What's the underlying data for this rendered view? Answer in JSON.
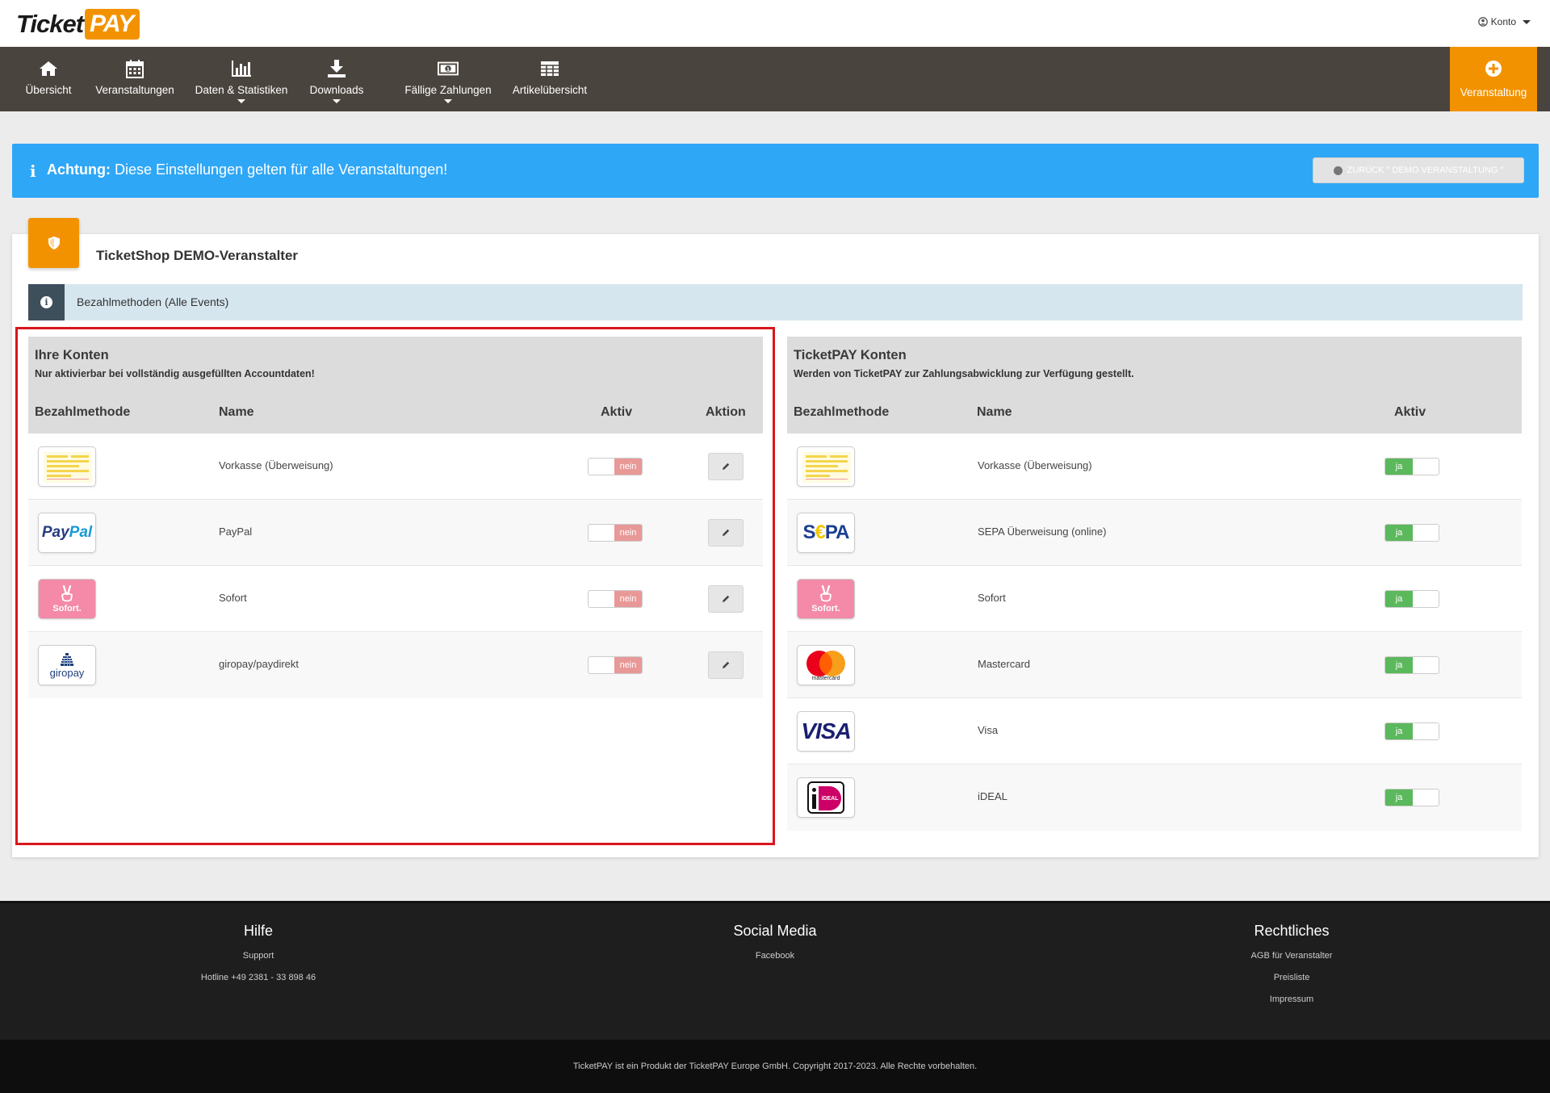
{
  "header": {
    "logo_left": "Ticket",
    "logo_right": "PAY",
    "account_label": "Konto"
  },
  "nav": {
    "items": [
      {
        "label": "Übersicht",
        "icon": "home-icon"
      },
      {
        "label": "Veranstaltungen",
        "icon": "calendar-icon"
      },
      {
        "label": "Daten & Statistiken",
        "icon": "bar-chart-icon"
      },
      {
        "label": "Downloads",
        "icon": "download-icon"
      },
      {
        "label": "Fällige Zahlungen",
        "icon": "money-icon"
      },
      {
        "label": "Artikelübersicht",
        "icon": "table-icon"
      }
    ],
    "cta_label": "Veranstaltung"
  },
  "alert": {
    "strong": "Achtung:",
    "text": " Diese Einstellungen gelten für alle Veranstaltungen!",
    "back_button": "ZURÜCK \" DEMO VERANSTALTUNG \""
  },
  "panel": {
    "title": "TicketShop DEMO-Veranstalter",
    "info": "Bezahlmethoden (Alle Events)"
  },
  "own_accounts": {
    "title": "Ihre Konten",
    "subtitle": "Nur aktivierbar bei vollständig ausgefüllten Accountdaten!",
    "columns": [
      "Bezahlmethode",
      "Name",
      "Aktiv",
      "Aktion"
    ],
    "rows": [
      {
        "name": "Vorkasse (Überweisung)",
        "logo": "transfer-form-icon",
        "active_label": "nein"
      },
      {
        "name": "PayPal",
        "logo": "paypal-logo",
        "active_label": "nein"
      },
      {
        "name": "Sofort",
        "logo": "sofort-logo",
        "active_label": "nein"
      },
      {
        "name": "giropay/paydirekt",
        "logo": "giropay-logo",
        "active_label": "nein"
      }
    ]
  },
  "ticketpay_accounts": {
    "title": "TicketPAY Konten",
    "subtitle": "Werden von TicketPAY zur Zahlungsabwicklung zur Verfügung gestellt.",
    "columns": [
      "Bezahlmethode",
      "Name",
      "Aktiv"
    ],
    "rows": [
      {
        "name": "Vorkasse (Überweisung)",
        "logo": "transfer-form-icon",
        "active_label": "ja"
      },
      {
        "name": "SEPA Überweisung (online)",
        "logo": "sepa-logo",
        "active_label": "ja"
      },
      {
        "name": "Sofort",
        "logo": "sofort-logo",
        "active_label": "ja"
      },
      {
        "name": "Mastercard",
        "logo": "mastercard-logo",
        "active_label": "ja"
      },
      {
        "name": "Visa",
        "logo": "visa-logo",
        "active_label": "ja"
      },
      {
        "name": "iDEAL",
        "logo": "ideal-logo",
        "active_label": "ja"
      }
    ]
  },
  "logo_text": {
    "paypal_a": "Pay",
    "paypal_b": "Pal",
    "sofort": "Sofort.",
    "giropay": "giropay",
    "sepa_a": "S",
    "sepa_b": "€",
    "sepa_c": "PA",
    "mastercard": "mastercard",
    "visa": "VISA",
    "ideal": "iDEAL"
  },
  "footer": {
    "help": {
      "title": "Hilfe",
      "links": [
        "Support",
        "Hotline +49 2381 - 33 898 46"
      ]
    },
    "social": {
      "title": "Social Media",
      "links": [
        "Facebook"
      ]
    },
    "legal": {
      "title": "Rechtliches",
      "links": [
        "AGB für Veranstalter",
        "Preisliste",
        "Impressum"
      ]
    },
    "copyright": "TicketPAY ist ein Produkt der TicketPAY Europe GmbH. Copyright 2017-2023. Alle Rechte vorbehalten."
  },
  "colors": {
    "brand_orange": "#f39200",
    "nav_bg": "#4a443e",
    "alert_blue": "#2ea7f7",
    "toggle_off": "#e99898",
    "toggle_on": "#5cb85c",
    "highlight_red": "#d9161d"
  }
}
